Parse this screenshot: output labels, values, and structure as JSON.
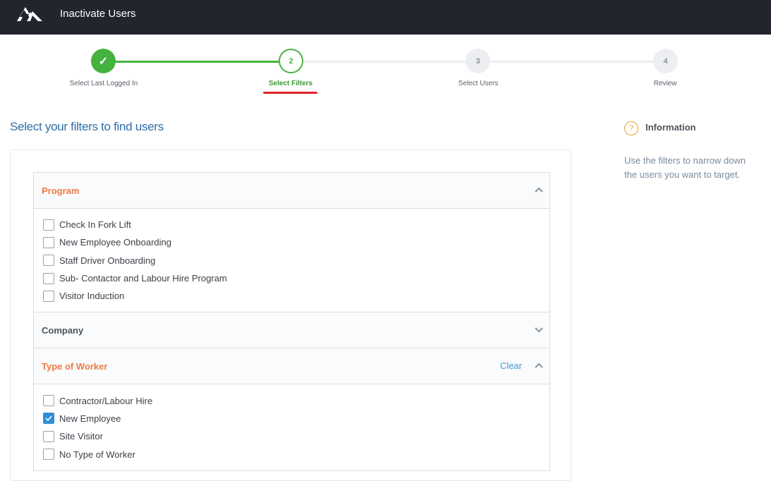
{
  "header": {
    "title": "Inactivate Users",
    "logo_icon": "mountain-logo-icon"
  },
  "stepper": {
    "steps": [
      {
        "number": "1",
        "label": "Select Last Logged In",
        "state": "done"
      },
      {
        "number": "2",
        "label": "Select Filters",
        "state": "active"
      },
      {
        "number": "3",
        "label": "Select Users",
        "state": "todo"
      },
      {
        "number": "4",
        "label": "Review",
        "state": "todo"
      }
    ],
    "check_glyph": "✓"
  },
  "main": {
    "heading": "Select your filters to find users"
  },
  "filters": {
    "program": {
      "title": "Program",
      "expanded": true,
      "options": [
        {
          "label": "Check In Fork Lift",
          "checked": false
        },
        {
          "label": "New Employee Onboarding",
          "checked": false
        },
        {
          "label": "Staff Driver Onboarding",
          "checked": false
        },
        {
          "label": "Sub- Contactor and Labour Hire Program",
          "checked": false
        },
        {
          "label": "Visitor Induction",
          "checked": false
        }
      ]
    },
    "company": {
      "title": "Company",
      "expanded": false
    },
    "type_of_worker": {
      "title": "Type of Worker",
      "clear_label": "Clear",
      "expanded": true,
      "options": [
        {
          "label": "Contractor/Labour Hire",
          "checked": false
        },
        {
          "label": "New Employee",
          "checked": true
        },
        {
          "label": "Site Visitor",
          "checked": false
        },
        {
          "label": "No Type of Worker",
          "checked": false
        }
      ]
    }
  },
  "info": {
    "icon": "?",
    "title": "Information",
    "text": "Use the filters to narrow down the users you want to target."
  },
  "colors": {
    "header_bg": "#22252d",
    "step_green": "#45b23f",
    "active_underline": "#e3242b",
    "heading_blue": "#2f6ea8",
    "filter_orange": "#f07a44",
    "link_blue": "#3a9bd6",
    "checkbox_blue": "#2f8ed8",
    "info_amber": "#e6a02c"
  }
}
